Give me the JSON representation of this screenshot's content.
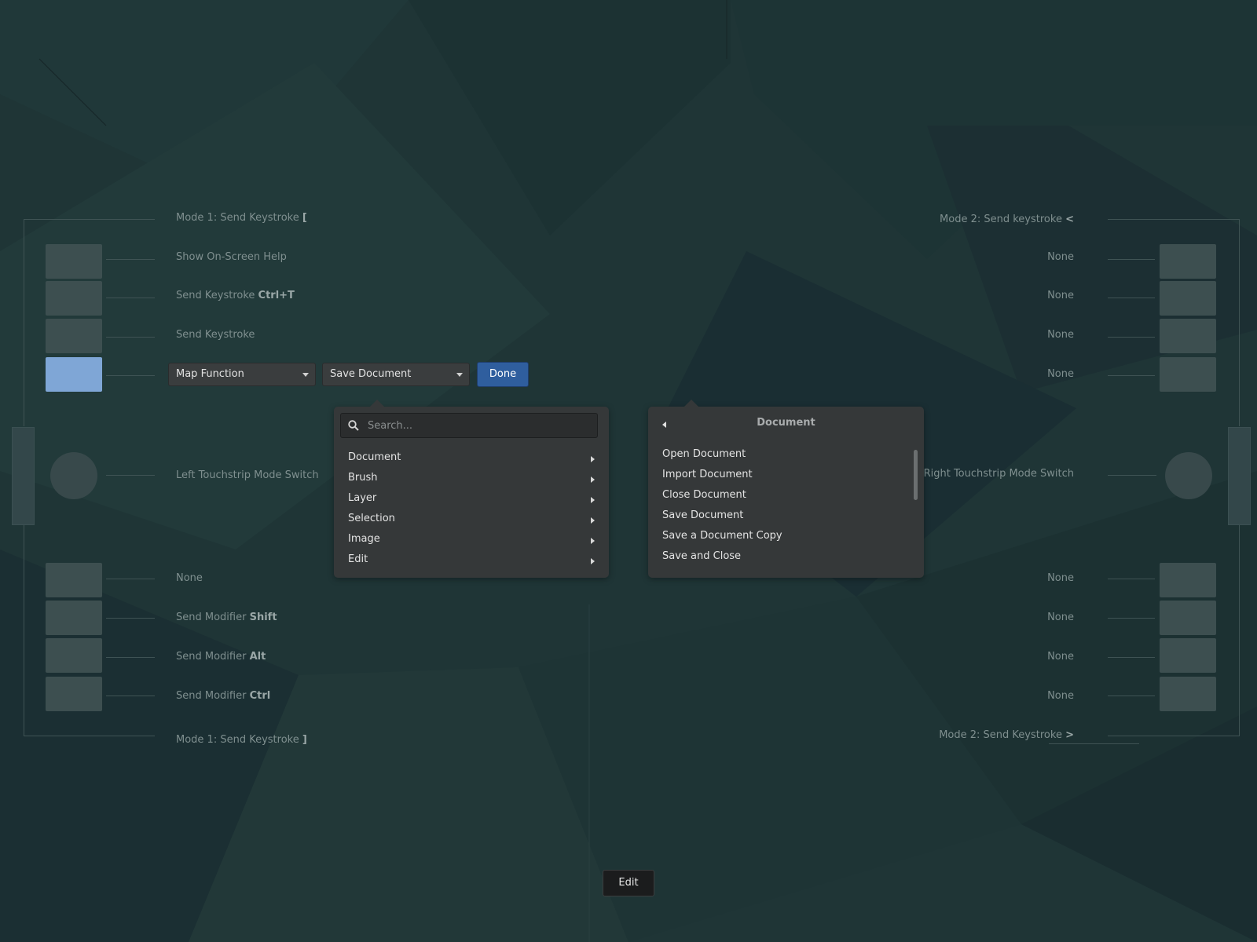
{
  "left": {
    "top_label_prefix": "Mode 1: Send Keystroke",
    "top_label_key": "[",
    "rows": [
      {
        "prefix": "Show On-Screen Help",
        "key": ""
      },
      {
        "prefix": "Send Keystroke",
        "key": "Ctrl+T"
      },
      {
        "prefix": "Send Keystroke",
        "key": ""
      }
    ],
    "touchstrip": "Left Touchstrip Mode Switch",
    "bottom_rows": [
      {
        "prefix": "None",
        "key": ""
      },
      {
        "prefix": "Send Modifier",
        "key": "Shift"
      },
      {
        "prefix": "Send Modifier",
        "key": "Alt"
      },
      {
        "prefix": "Send Modifier",
        "key": "Ctrl"
      }
    ],
    "bottom_label_prefix": "Mode 1: Send Keystroke",
    "bottom_label_key": "]"
  },
  "right": {
    "top_label_prefix": "Mode 2: Send keystroke",
    "top_label_key": "<",
    "rows": [
      "None",
      "None",
      "None",
      "None"
    ],
    "touchstrip": "Right Touchstrip Mode Switch",
    "bottom_rows": [
      "None",
      "None",
      "None",
      "None"
    ],
    "bottom_label_prefix": "Mode 2: Send Keystroke",
    "bottom_label_key": ">"
  },
  "editor": {
    "type_combo": "Map Function",
    "action_combo": "Save Document",
    "done": "Done"
  },
  "menu": {
    "search_placeholder": "Search...",
    "items": [
      "Document",
      "Brush",
      "Layer",
      "Selection",
      "Image",
      "Edit"
    ]
  },
  "submenu": {
    "title": "Document",
    "items": [
      "Open Document",
      "Import Document",
      "Close Document",
      "Save Document",
      "Save a Document Copy",
      "Save and Close"
    ]
  },
  "footer": {
    "edit": "Edit"
  },
  "colors": {
    "selected_button": "#7fa6d6",
    "done_button": "#2f5e9e"
  }
}
